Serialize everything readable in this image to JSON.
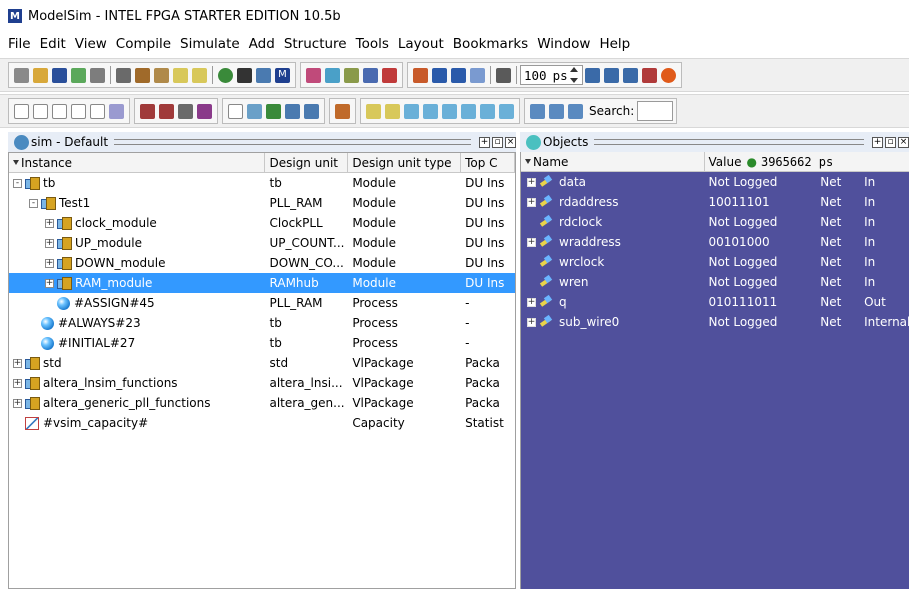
{
  "window": {
    "title": "ModelSim - INTEL FPGA STARTER EDITION 10.5b"
  },
  "menu": [
    "File",
    "Edit",
    "View",
    "Compile",
    "Simulate",
    "Add",
    "Structure",
    "Tools",
    "Layout",
    "Bookmarks",
    "Window",
    "Help"
  ],
  "toolbar": {
    "time_value": "100",
    "time_unit": "ps",
    "search_label": "Search:"
  },
  "sim_panel": {
    "title": "sim - Default",
    "columns": [
      "Instance",
      "Design unit",
      "Design unit type",
      "Top C"
    ],
    "rows": [
      {
        "name": "tb",
        "unit": "tb",
        "type": "Module",
        "top": "DU Ins",
        "depth": 0,
        "exp": "-",
        "icon": "inst"
      },
      {
        "name": "Test1",
        "unit": "PLL_RAM",
        "type": "Module",
        "top": "DU Ins",
        "depth": 1,
        "exp": "-",
        "icon": "inst"
      },
      {
        "name": "clock_module",
        "unit": "ClockPLL",
        "type": "Module",
        "top": "DU Ins",
        "depth": 2,
        "exp": "+",
        "icon": "inst"
      },
      {
        "name": "UP_module",
        "unit": "UP_COUNT...",
        "type": "Module",
        "top": "DU Ins",
        "depth": 2,
        "exp": "+",
        "icon": "inst"
      },
      {
        "name": "DOWN_module",
        "unit": "DOWN_CO...",
        "type": "Module",
        "top": "DU Ins",
        "depth": 2,
        "exp": "+",
        "icon": "inst"
      },
      {
        "name": "RAM_module",
        "unit": "RAMhub",
        "type": "Module",
        "top": "DU Ins",
        "depth": 2,
        "exp": "+",
        "icon": "inst",
        "selected": true
      },
      {
        "name": "#ASSIGN#45",
        "unit": "PLL_RAM",
        "type": "Process",
        "top": "-",
        "depth": 2,
        "exp": "",
        "icon": "proc"
      },
      {
        "name": "#ALWAYS#23",
        "unit": "tb",
        "type": "Process",
        "top": "-",
        "depth": 1,
        "exp": "",
        "icon": "proc"
      },
      {
        "name": "#INITIAL#27",
        "unit": "tb",
        "type": "Process",
        "top": "-",
        "depth": 1,
        "exp": "",
        "icon": "proc"
      },
      {
        "name": "std",
        "unit": "std",
        "type": "VlPackage",
        "top": "Packa",
        "depth": 0,
        "exp": "+",
        "icon": "inst"
      },
      {
        "name": "altera_lnsim_functions",
        "unit": "altera_lnsi...",
        "type": "VlPackage",
        "top": "Packa",
        "depth": 0,
        "exp": "+",
        "icon": "inst"
      },
      {
        "name": "altera_generic_pll_functions",
        "unit": "altera_gen...",
        "type": "VlPackage",
        "top": "Packa",
        "depth": 0,
        "exp": "+",
        "icon": "inst"
      },
      {
        "name": "#vsim_capacity#",
        "unit": "",
        "type": "Capacity",
        "top": "Statist",
        "depth": 0,
        "exp": "",
        "icon": "cap"
      }
    ]
  },
  "objects_panel": {
    "title": "Objects",
    "columns": {
      "name": "Name",
      "value": "Value",
      "time": "3965662 ps"
    },
    "rows": [
      {
        "name": "data",
        "value": "Not Logged",
        "kind": "Net",
        "mode": "In",
        "exp": "+"
      },
      {
        "name": "rdaddress",
        "value": "10011101",
        "kind": "Net",
        "mode": "In",
        "exp": "+"
      },
      {
        "name": "rdclock",
        "value": "Not Logged",
        "kind": "Net",
        "mode": "In",
        "exp": ""
      },
      {
        "name": "wraddress",
        "value": "00101000",
        "kind": "Net",
        "mode": "In",
        "exp": "+"
      },
      {
        "name": "wrclock",
        "value": "Not Logged",
        "kind": "Net",
        "mode": "In",
        "exp": ""
      },
      {
        "name": "wren",
        "value": "Not Logged",
        "kind": "Net",
        "mode": "In",
        "exp": ""
      },
      {
        "name": "q",
        "value": "010111011",
        "kind": "Net",
        "mode": "Out",
        "exp": "+"
      },
      {
        "name": "sub_wire0",
        "value": "Not Logged",
        "kind": "Net",
        "mode": "Internal",
        "exp": "+"
      }
    ]
  }
}
